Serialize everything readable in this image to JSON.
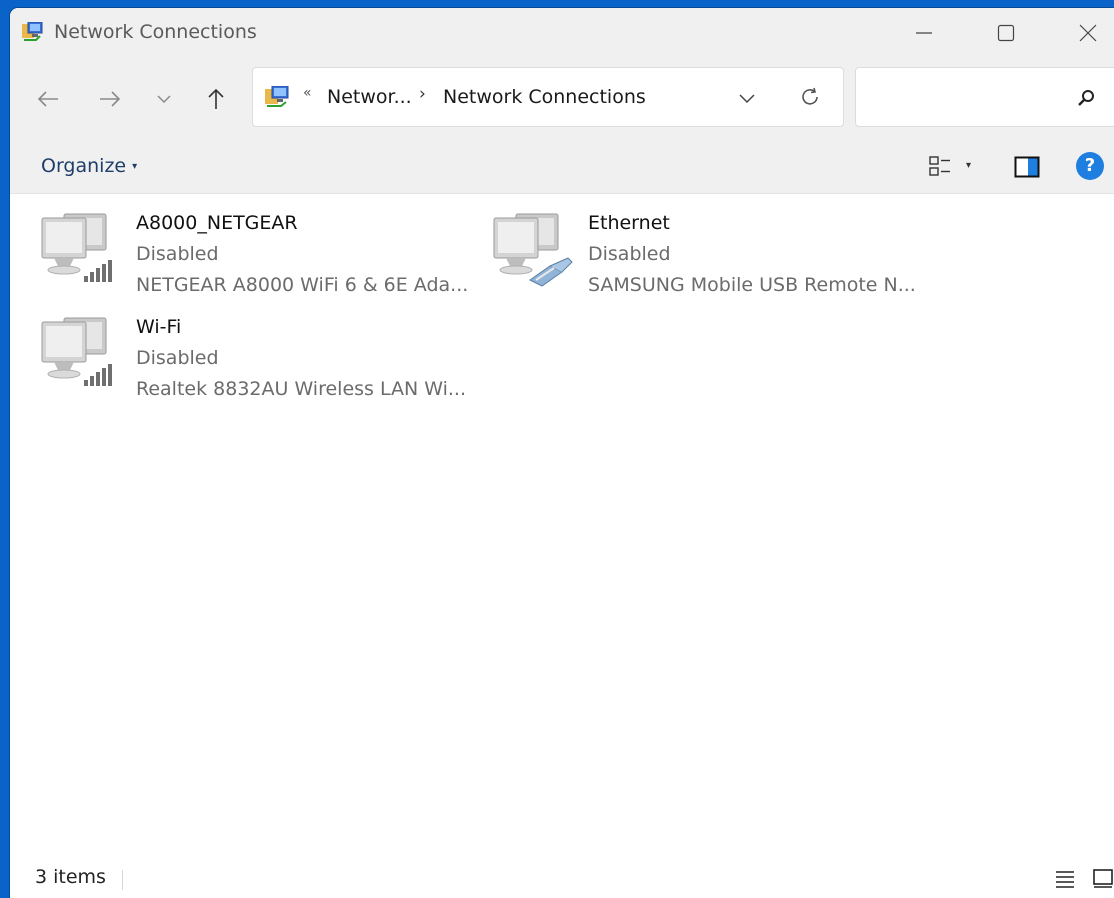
{
  "window": {
    "title": "Network Connections"
  },
  "nav": {
    "breadcrumb_overflow": "«",
    "breadcrumb": [
      "Networ...",
      "Network Connections"
    ],
    "separator": "›",
    "search_placeholder": ""
  },
  "commandbar": {
    "organize_label": "Organize"
  },
  "items": [
    {
      "name": "A8000_NETGEAR",
      "status": "Disabled",
      "device": "NETGEAR A8000 WiFi 6 & 6E Ada...",
      "icon": "wireless-adapter-icon"
    },
    {
      "name": "Ethernet",
      "status": "Disabled",
      "device": "SAMSUNG Mobile USB Remote N...",
      "icon": "ethernet-adapter-icon"
    },
    {
      "name": "Wi-Fi",
      "status": "Disabled",
      "device": "Realtek 8832AU Wireless LAN Wi...",
      "icon": "wireless-adapter-icon"
    }
  ],
  "statusbar": {
    "count": "3 items"
  },
  "colors": {
    "desktop": "#0a63c9",
    "chrome": "#f0f0f0",
    "help": "#1e7fe0"
  }
}
